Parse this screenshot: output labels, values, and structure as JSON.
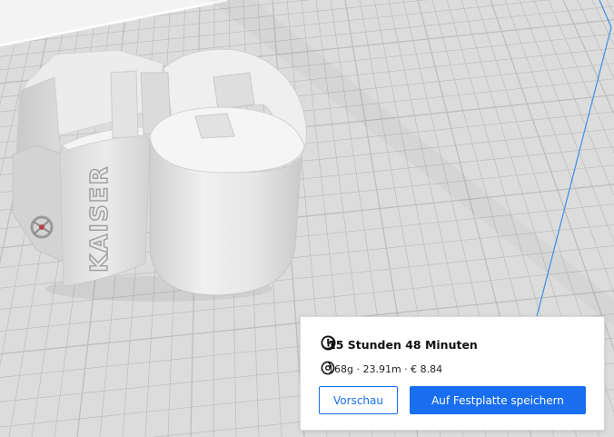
{
  "print_summary": {
    "print_time": "15 Stunden 48 Minuten",
    "material_summary": "168g · 23.91m · € 8.84",
    "preview_button": "Vorschau",
    "save_button": "Auf Festplatte speichern"
  },
  "model": {
    "embossed_text": "KAISER"
  },
  "colors": {
    "accent": "#196ef0",
    "build_plate": "#dcdcdc",
    "grid_line": "#bdbdbd",
    "build_volume_edge": "#3a8ee6",
    "model": "#e9e9e9"
  },
  "icons": {
    "time": "clock-icon",
    "info": "info-icon",
    "material": "spool-icon"
  }
}
